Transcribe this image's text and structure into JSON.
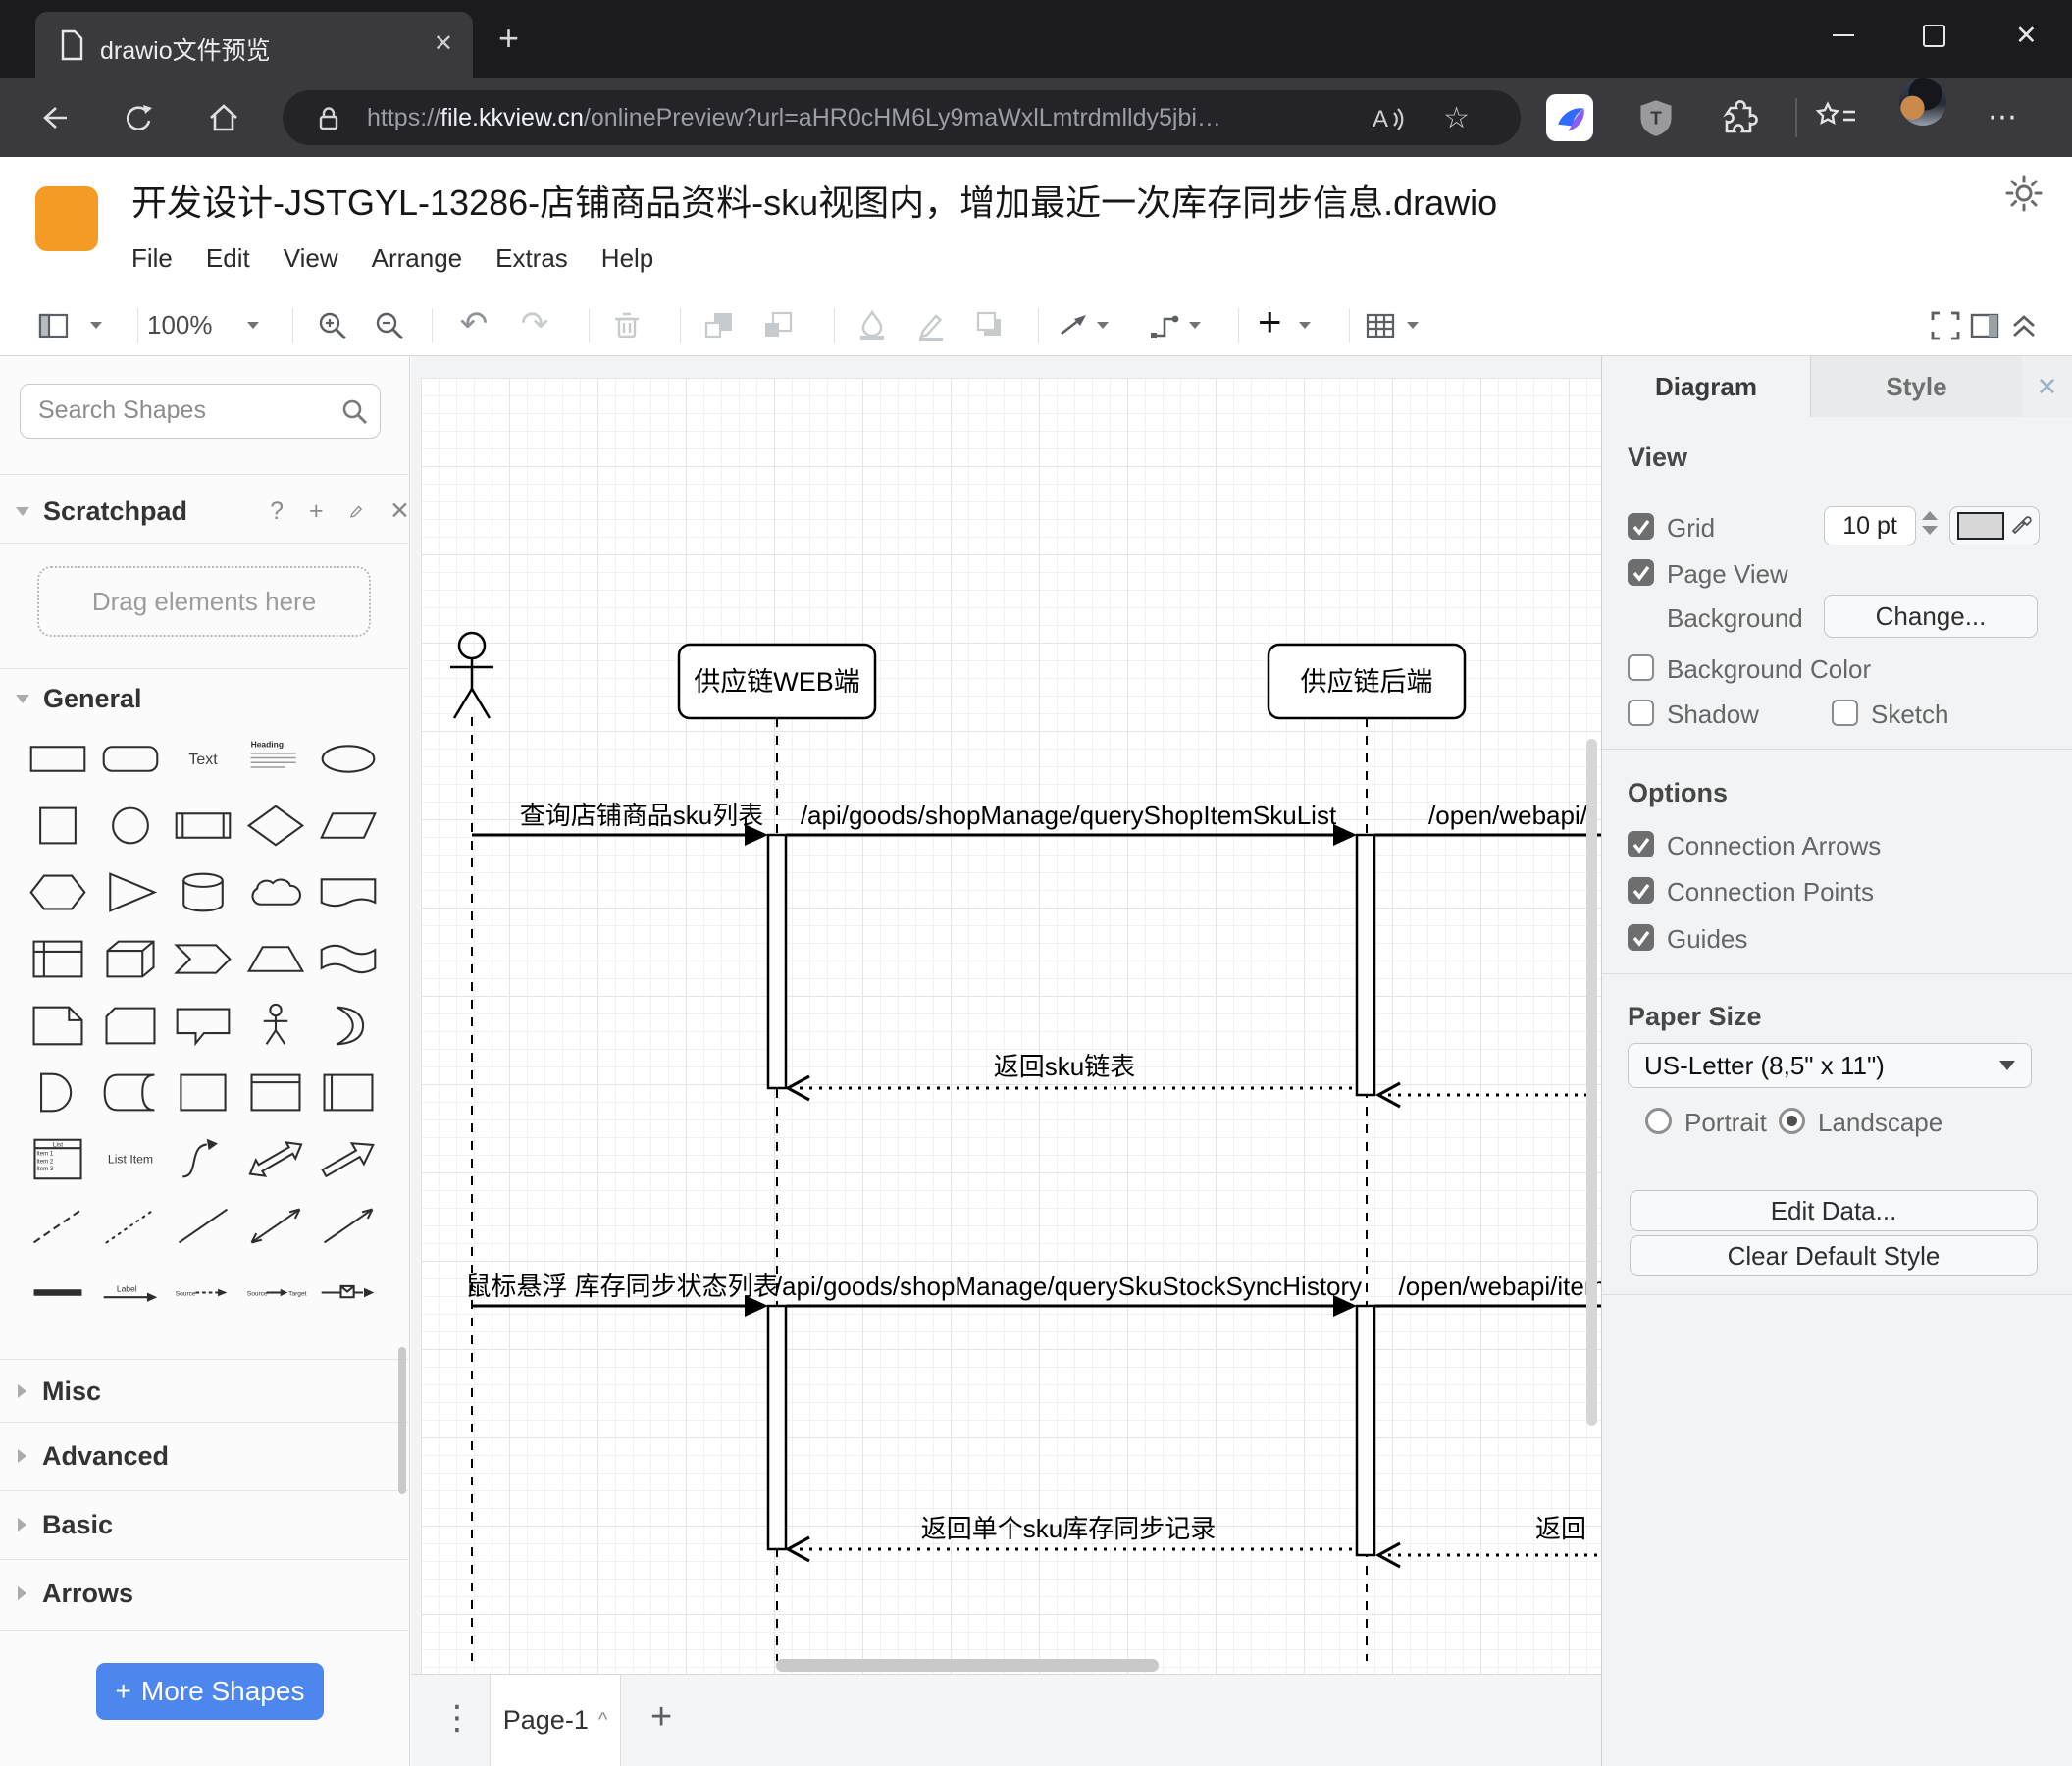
{
  "browser": {
    "tab_title": "drawio文件预览",
    "url": {
      "scheme": "https://",
      "host": "file.kkview.cn",
      "path": "/onlinePreview?url=aHR0cHM6Ly9maWxlLmtrdmlldy5jbi…"
    }
  },
  "icons": {
    "close": "✕",
    "new_tab": "+",
    "overflow_menu": "⋯",
    "favorite_star": "☆",
    "vertical_dots": "⋮",
    "page_plus": "+",
    "page_caret": "^",
    "undo": "↶",
    "redo": "↷",
    "help": "?",
    "add": "+",
    "caret": "▾"
  },
  "app": {
    "title": "开发设计-JSTGYL-13286-店铺商品资料-sku视图内，增加最近一次库存同步信息.drawio",
    "menus": [
      "File",
      "Edit",
      "View",
      "Arrange",
      "Extras",
      "Help"
    ],
    "toolbar": {
      "zoom": "100%"
    },
    "logo_color": "#f49b25"
  },
  "sidebar": {
    "search_placeholder": "Search Shapes",
    "scratchpad": "Scratchpad",
    "drag_hint": "Drag elements here",
    "sections": {
      "general": "General",
      "misc": "Misc",
      "advanced": "Advanced",
      "basic": "Basic",
      "arrows": "Arrows"
    },
    "more_shapes": "More Shapes",
    "accent": "#4d86ec",
    "shapes": [
      "rectangle",
      "rounded-rectangle",
      "text",
      "heading",
      "ellipse",
      "square",
      "circle",
      "process",
      "diamond",
      "parallelogram",
      "hexagon",
      "triangle",
      "cylinder",
      "cloud",
      "document",
      "internal-storage",
      "cube",
      "step",
      "trapezoid",
      "tape",
      "note",
      "card",
      "callout",
      "actor",
      "or",
      "and",
      "data-storage",
      "container",
      "vertical-container",
      "horizontal-container",
      "list",
      "list-item",
      "curve",
      "bidirectional-arrow",
      "arrow",
      "dashed-line",
      "dotted-line",
      "line",
      "bidirectional-connector",
      "directional-connector",
      "link",
      "label-arrow",
      "source-target",
      "source-target-2",
      "annotation-arrow"
    ],
    "shape_texts": {
      "text": "Text",
      "heading": "Heading",
      "list": "List",
      "list_items": [
        "Item 1",
        "Item 2",
        "Item 3"
      ],
      "list_item": "List Item",
      "label": "Label",
      "source": "Source",
      "target": "Target"
    }
  },
  "canvas": {
    "diagram": {
      "lifelines": [
        "供应链WEB端",
        "供应链后端"
      ],
      "messages": [
        {
          "label": "查询店铺商品sku列表",
          "kind": "sync"
        },
        {
          "label": "/api/goods/shopManage/queryShopItemSkuList",
          "kind": "sync"
        },
        {
          "label": "/open/webapi/",
          "kind": "sync"
        },
        {
          "label": "返回sku链表",
          "kind": "return"
        },
        {
          "label": "鼠标悬浮 库存同步状态列表",
          "kind": "sync"
        },
        {
          "label": "/api/goods/shopManage/querySkuStockSyncHistory",
          "kind": "sync"
        },
        {
          "label": "/open/webapi/item",
          "kind": "sync"
        },
        {
          "label": "返回单个sku库存同步记录",
          "kind": "return"
        },
        {
          "label": "返回",
          "kind": "return"
        }
      ]
    }
  },
  "panel": {
    "tabs": {
      "diagram": "Diagram",
      "style": "Style"
    },
    "active_tab": "Diagram",
    "view": {
      "heading": "View",
      "grid": "Grid",
      "grid_size": "10 pt",
      "grid_swatch": "#d7d7d7",
      "page_view": "Page View",
      "background": "Background",
      "change": "Change...",
      "background_color": "Background Color",
      "shadow": "Shadow",
      "sketch": "Sketch"
    },
    "options": {
      "heading": "Options",
      "connection_arrows": "Connection Arrows",
      "connection_points": "Connection Points",
      "guides": "Guides"
    },
    "paper": {
      "heading": "Paper Size",
      "size": "US-Letter (8,5\" x 11\")",
      "portrait": "Portrait",
      "landscape": "Landscape",
      "orientation": "landscape"
    },
    "actions": {
      "edit_data": "Edit Data...",
      "clear_default_style": "Clear Default Style"
    }
  },
  "footer": {
    "page_tab": "Page-1"
  }
}
